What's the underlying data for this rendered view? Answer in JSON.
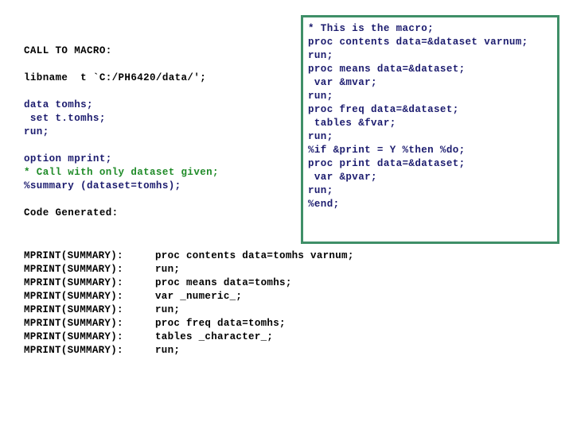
{
  "slide": {
    "background_color": "#ffffff",
    "text_colors": {
      "black": "#000000",
      "navy": "#1b1b6e",
      "green": "#1f8b28",
      "box_border": "#3f8f68"
    }
  },
  "left_column": {
    "heading": "CALL TO MACRO:",
    "libname_line": "libname  t `C:/PH6420/data/';",
    "data_step": [
      "data tomhs;",
      " set t.tomhs;",
      "run;"
    ],
    "option_block": [
      "option mprint;",
      "* Call with only dataset given;",
      "%summary (dataset=tomhs);"
    ],
    "generated_heading": "Code Generated:"
  },
  "generated_code": {
    "label": "MPRINT(SUMMARY):",
    "rows": [
      {
        "label": "MPRINT(SUMMARY):",
        "code": "proc contents data=tomhs varnum;"
      },
      {
        "label": "MPRINT(SUMMARY):",
        "code": "run;"
      },
      {
        "label": "MPRINT(SUMMARY):",
        "code": "proc means data=tomhs;"
      },
      {
        "label": "MPRINT(SUMMARY):",
        "code": "var _numeric_;"
      },
      {
        "label": "MPRINT(SUMMARY):",
        "code": "run;"
      },
      {
        "label": "MPRINT(SUMMARY):",
        "code": "proc freq data=tomhs;"
      },
      {
        "label": "MPRINT(SUMMARY):",
        "code": "tables _character_;"
      },
      {
        "label": "MPRINT(SUMMARY):",
        "code": "run;"
      }
    ]
  },
  "macro_box": {
    "lines": [
      "* This is the macro;",
      "proc contents data=&dataset varnum;",
      "run;",
      "proc means data=&dataset;",
      " var &mvar;",
      "run;",
      "proc freq data=&dataset;",
      " tables &fvar;",
      "run;",
      "%if &print = Y %then %do;",
      "proc print data=&dataset;",
      " var &pvar;",
      "run;",
      "%end;"
    ]
  }
}
